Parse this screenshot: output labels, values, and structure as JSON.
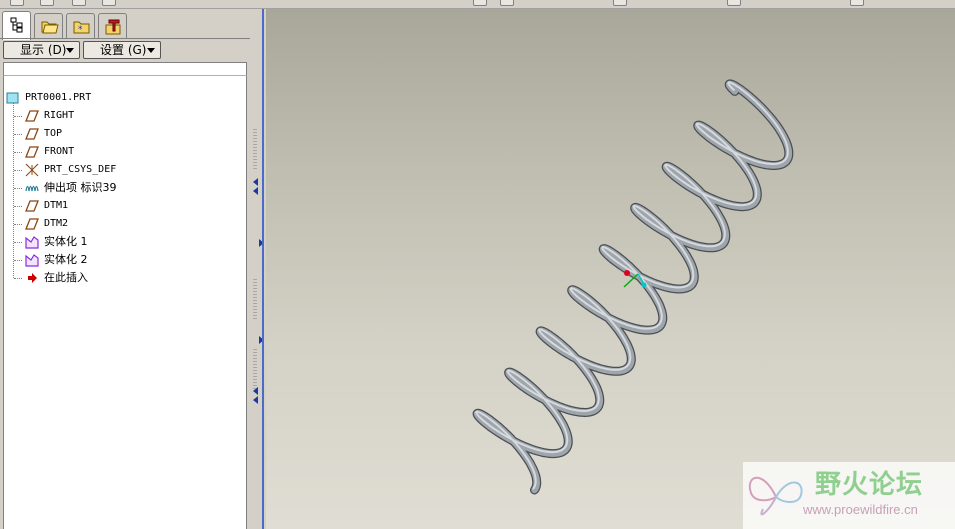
{
  "tree_panel": {
    "display_menu": "显示 (D)",
    "settings_menu": "设置 (G)",
    "root": {
      "label": "PRT0001.PRT",
      "icon": "part-icon"
    },
    "items": [
      {
        "label": "RIGHT",
        "icon": "datum-plane-icon"
      },
      {
        "label": "TOP",
        "icon": "datum-plane-icon"
      },
      {
        "label": "FRONT",
        "icon": "datum-plane-icon"
      },
      {
        "label": "PRT_CSYS_DEF",
        "icon": "coordinate-system-icon"
      },
      {
        "label": "伸出项 标识39",
        "icon": "sweep-protrusion-icon"
      },
      {
        "label": "DTM1",
        "icon": "datum-plane-icon"
      },
      {
        "label": "DTM2",
        "icon": "datum-plane-icon"
      },
      {
        "label": "实体化 1",
        "icon": "solidify-icon"
      },
      {
        "label": "实体化 2",
        "icon": "solidify-icon"
      },
      {
        "label": "在此插入",
        "icon": "insert-here-arrow-icon"
      }
    ]
  },
  "tabs": [
    {
      "name": "model-tree-tab",
      "icon": "model-tree-icon",
      "active": true
    },
    {
      "name": "folder-browser-tab",
      "icon": "folder-browser-icon",
      "active": false
    },
    {
      "name": "favorites-tab",
      "icon": "favorites-icon",
      "active": false
    },
    {
      "name": "connections-tab",
      "icon": "connections-icon",
      "active": false
    }
  ],
  "watermark": {
    "title": "野火论坛",
    "url": "www.proewildfire.cn"
  },
  "colors": {
    "datum_plane": "#8b4513",
    "solidify": "#8a2be2",
    "insert_arrow": "#cc0000",
    "spring": "#9ea5ab",
    "viewport_top": "#a8a79a",
    "viewport_bottom": "#e0ded4"
  }
}
